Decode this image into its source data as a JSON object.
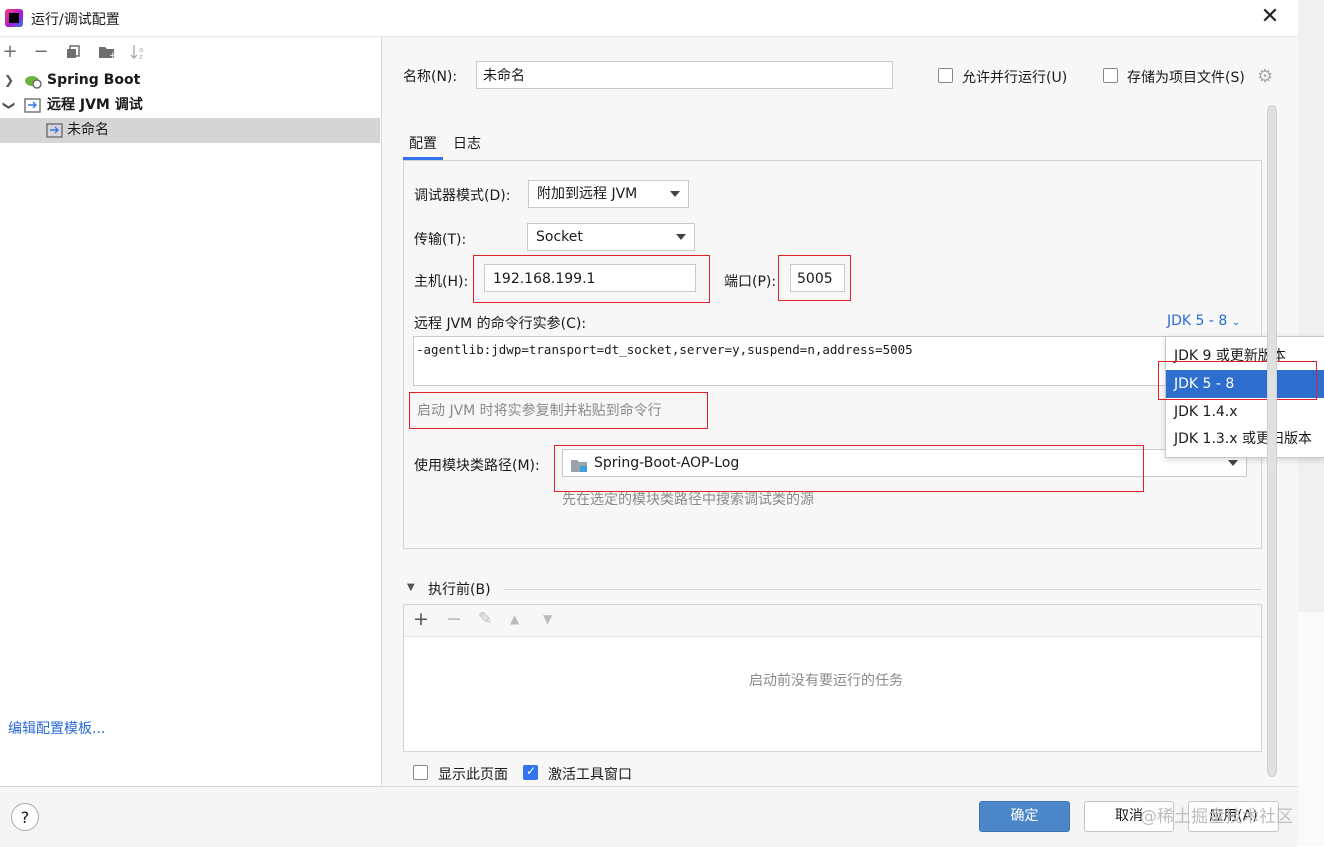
{
  "window": {
    "title": "运行/调试配置",
    "close": "✕"
  },
  "left_panel": {
    "toolbar": [
      "+",
      "−",
      "copy",
      "folder",
      "sort"
    ],
    "tree": [
      {
        "label": "Spring Boot",
        "expanded": false
      },
      {
        "label": "远程 JVM 调试",
        "expanded": true
      },
      {
        "label": "未命名",
        "selected": true
      }
    ],
    "edit_templates": "编辑配置模板..."
  },
  "header": {
    "name_label": "名称(N):",
    "name_value": "未命名",
    "allow_parallel": "允许并行运行(U)",
    "store_as_file": "存储为项目文件(S)"
  },
  "tabs": [
    {
      "label": "配置",
      "active": true
    },
    {
      "label": "日志",
      "active": false
    }
  ],
  "config": {
    "debugger_mode_label": "调试器模式(D):",
    "debugger_mode_value": "附加到远程 JVM",
    "transport_label": "传输(T):",
    "transport_value": "Socket",
    "host_label": "主机(H):",
    "host_value": "192.168.199.1",
    "port_label": "端口(P):",
    "port_value": "5005",
    "cmdline_label": "远程 JVM 的命令行实参(C):",
    "jdk_selector": "JDK 5 - 8",
    "cmdline_value": "-agentlib:jdwp=transport=dt_socket,server=y,suspend=n,address=5005",
    "cmdline_hint": "启动 JVM 时将实参复制并粘贴到命令行",
    "module_label": "使用模块类路径(M):",
    "module_value": "Spring-Boot-AOP-Log",
    "module_hint": "先在选定的模块类路径中搜索调试类的源"
  },
  "jdk_menu": {
    "items": [
      "JDK 9 或更新版本",
      "JDK 5 - 8",
      "JDK 1.4.x",
      "JDK 1.3.x 或更旧版本"
    ],
    "selected_index": 1
  },
  "before_launch": {
    "title": "执行前(B)",
    "toolbar": [
      "+",
      "−",
      "✎",
      "▲",
      "▼"
    ],
    "empty_text": "启动前没有要运行的任务"
  },
  "options": {
    "show_page": {
      "label": "显示此页面",
      "checked": false
    },
    "activate_tool_window": {
      "label": "激活工具窗口",
      "checked": true
    }
  },
  "buttons": {
    "ok": "确定",
    "cancel": "取消",
    "apply": "应用(A)",
    "help": "?"
  },
  "watermark": "@稀土掘金技术社区",
  "colors": {
    "accent": "#3574f0",
    "highlight_box": "#e0202a",
    "menu_selected": "#2d6ecf",
    "ok_button": "#4a86c8"
  }
}
